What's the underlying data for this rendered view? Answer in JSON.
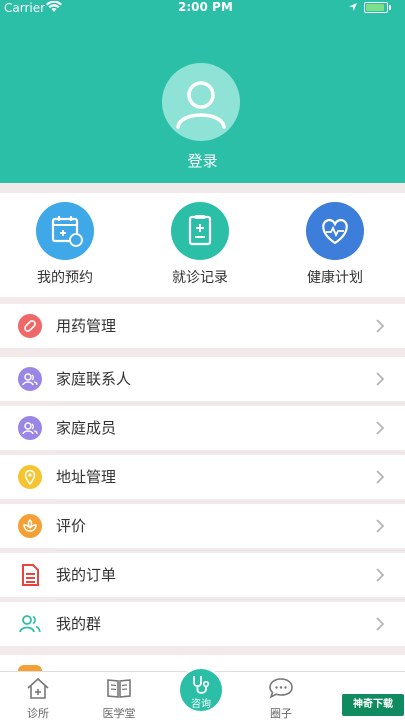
{
  "status_bar": {
    "carrier": "Carrier",
    "time": "2:00 PM"
  },
  "header": {
    "login_label": "登录"
  },
  "quick_actions": [
    {
      "label": "我的预约",
      "icon": "calendar-medicine-icon",
      "color": "#3fa8e8"
    },
    {
      "label": "就诊记录",
      "icon": "clipboard-plus-icon",
      "color": "#2bbfa8"
    },
    {
      "label": "健康计划",
      "icon": "heart-pulse-icon",
      "color": "#3c7ed9"
    }
  ],
  "menu": {
    "medication": {
      "label": "用药管理",
      "icon": "pill-icon",
      "color": "#f06767"
    },
    "family_contacts": {
      "label": "家庭联系人",
      "icon": "people-icon",
      "color": "#9a86e6"
    },
    "family_members": {
      "label": "家庭成员",
      "icon": "people-icon",
      "color": "#9a86e6"
    },
    "address": {
      "label": "地址管理",
      "icon": "location-pin-icon",
      "color": "#f5c531"
    },
    "review": {
      "label": "评价",
      "icon": "flower-icon",
      "color": "#f5a035"
    },
    "orders": {
      "label": "我的订单",
      "icon": "document-icon",
      "color": "#e8433c"
    },
    "groups": {
      "label": "我的群",
      "icon": "group-icon",
      "color": "#2bbfa8"
    }
  },
  "tabbar": {
    "clinic": "诊所",
    "academy": "医学堂",
    "consult": "咨询",
    "circle": "圈子"
  },
  "watermark": "神奇下载"
}
